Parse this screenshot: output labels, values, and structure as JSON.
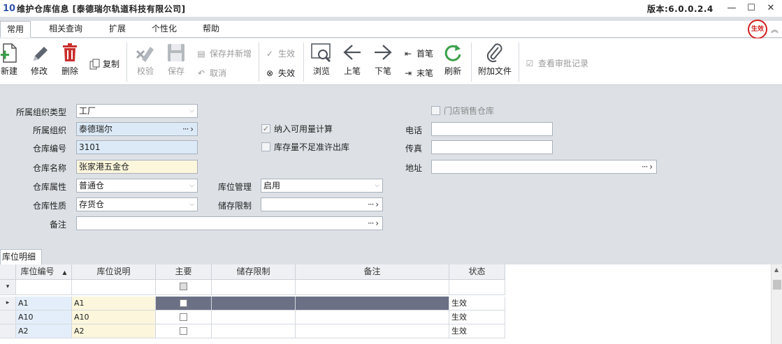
{
  "window": {
    "app_icon": "10",
    "title": "维护仓库信息 [泰德瑞尔轨道科技有限公司]",
    "version": "版本:6.0.0.2.4",
    "minimize": "—",
    "maximize": "☐",
    "close": "✕"
  },
  "menu": {
    "tabs": [
      {
        "label": "常用"
      },
      {
        "label": "相关查询"
      },
      {
        "label": "扩展"
      },
      {
        "label": "个性化"
      },
      {
        "label": "帮助"
      }
    ],
    "stamp_text": "生效",
    "collapse_glyph": "︽"
  },
  "toolbar": {
    "new": "新建",
    "edit": "修改",
    "delete": "删除",
    "copy": "复制",
    "verify": "校验",
    "save": "保存",
    "save_and_new": "保存并新增",
    "cancel": "取消",
    "activate": "生效",
    "deactivate": "失效",
    "browse": "浏览",
    "prev": "上笔",
    "next": "下笔",
    "first": "首笔",
    "last": "末笔",
    "refresh": "刷新",
    "attach": "附加文件",
    "audit": "查看审批记录"
  },
  "form": {
    "org_type_label": "所属组织类型",
    "org_type_value": "工厂",
    "org_label": "所属组织",
    "org_value": "泰德瑞尔",
    "code_label": "仓库编号",
    "code_value": "3101",
    "name_label": "仓库名称",
    "name_value": "张家港五金仓",
    "attr_label": "仓库属性",
    "attr_value": "普通仓",
    "nature_label": "仓库性质",
    "nature_value": "存货仓",
    "remark_label": "备注",
    "remark_value": "",
    "include_qty_label": "纳入可用量计算",
    "allow_negative_label": "库存量不足准许出库",
    "location_mgmt_label": "库位管理",
    "location_mgmt_value": "启用",
    "storage_limit_label": "储存限制",
    "storage_limit_value": "",
    "store_warehouse_label": "门店销售仓库",
    "phone_label": "电话",
    "phone_value": "",
    "fax_label": "传真",
    "fax_value": "",
    "address_label": "地址",
    "address_value": ""
  },
  "grid": {
    "tab_label": "库位明细",
    "sort_glyph": "▲",
    "columns": [
      "库位编号",
      "库位说明",
      "主要",
      "储存限制",
      "备注",
      "状态"
    ],
    "filter_row_glyph": "▾",
    "current_row_glyph": "▸",
    "rows": [
      {
        "code": "A1",
        "desc": "A1",
        "status": "生效"
      },
      {
        "code": "A10",
        "desc": "A10",
        "status": "生效"
      },
      {
        "code": "A2",
        "desc": "A2",
        "status": "生效"
      }
    ],
    "scroll_up": "▲"
  }
}
